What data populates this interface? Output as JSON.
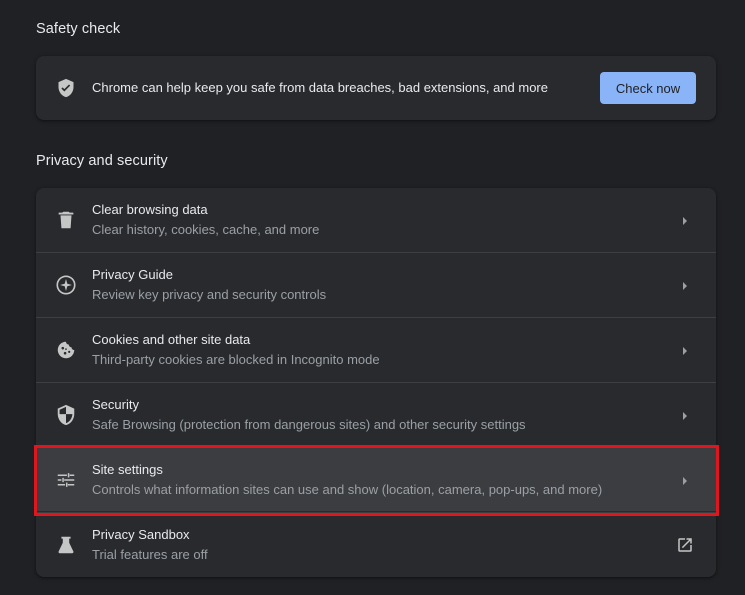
{
  "safety_check": {
    "title": "Safety check",
    "description": "Chrome can help keep you safe from data breaches, bad extensions, and more",
    "button_label": "Check now",
    "icon": "shield-check-icon"
  },
  "privacy": {
    "title": "Privacy and security",
    "rows": [
      {
        "title": "Clear browsing data",
        "subtitle": "Clear history, cookies, cache, and more",
        "icon": "trash-icon",
        "action": "chevron-right-icon"
      },
      {
        "title": "Privacy Guide",
        "subtitle": "Review key privacy and security controls",
        "icon": "compass-icon",
        "action": "chevron-right-icon"
      },
      {
        "title": "Cookies and other site data",
        "subtitle": "Third-party cookies are blocked in Incognito mode",
        "icon": "cookie-icon",
        "action": "chevron-right-icon"
      },
      {
        "title": "Security",
        "subtitle": "Safe Browsing (protection from dangerous sites) and other security settings",
        "icon": "shield-icon",
        "action": "chevron-right-icon"
      },
      {
        "title": "Site settings",
        "subtitle": "Controls what information sites can use and show (location, camera, pop-ups, and more)",
        "icon": "tune-sliders-icon",
        "action": "chevron-right-icon",
        "highlighted": true
      },
      {
        "title": "Privacy Sandbox",
        "subtitle": "Trial features are off",
        "icon": "flask-icon",
        "action": "open-in-new-icon"
      }
    ]
  },
  "colors": {
    "background": "#202124",
    "card": "#292a2d",
    "accent_button": "#8ab4f8",
    "highlight_border": "#e0161e",
    "primary_text": "#e8eaed",
    "secondary_text": "#9aa0a6"
  }
}
